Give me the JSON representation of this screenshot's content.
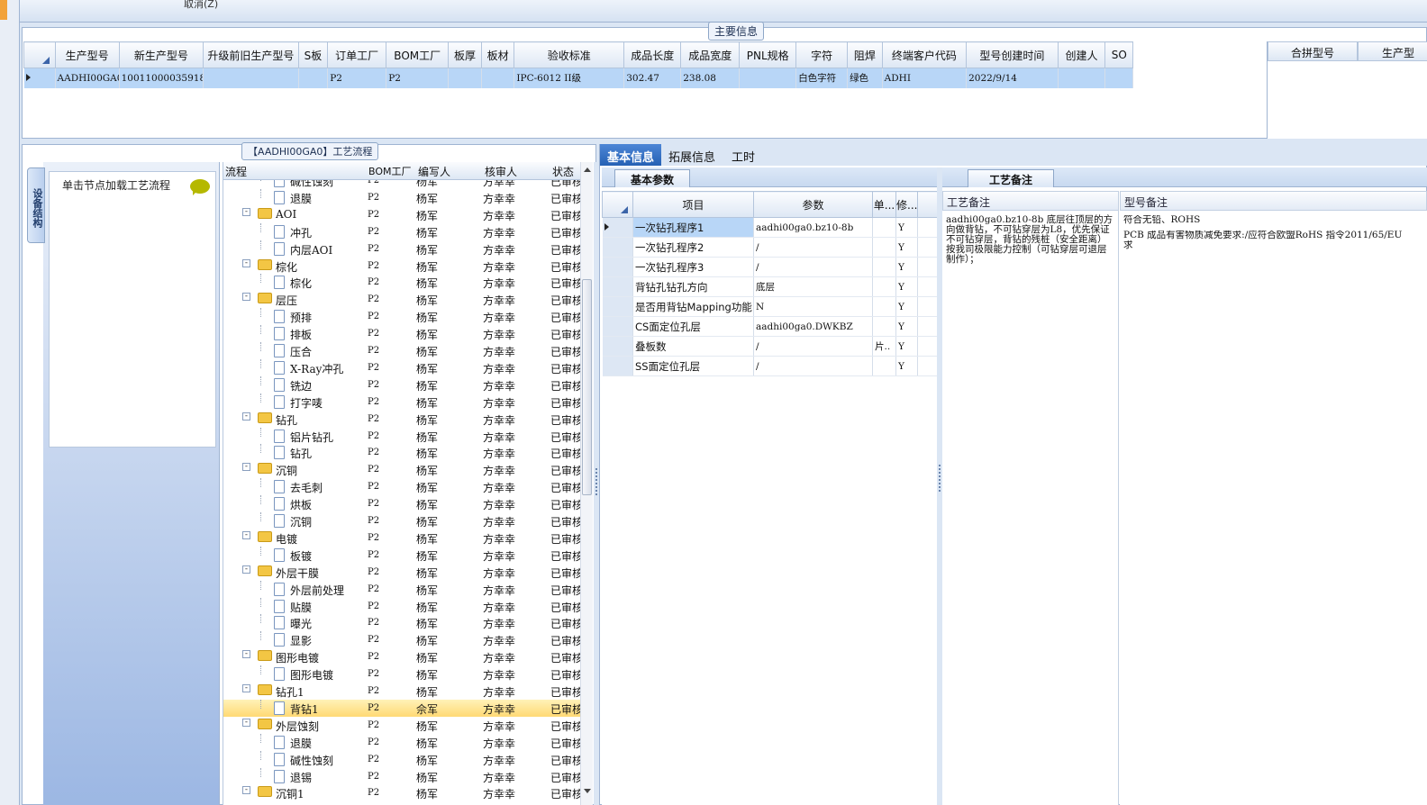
{
  "top_bar": {
    "cancel_label": "取消(Z)"
  },
  "main_info": {
    "group_title": "主要信息",
    "columns": [
      "生产型号",
      "新生产型号",
      "升级前旧生产型号",
      "S板",
      "订单工厂",
      "BOM工厂",
      "板厚",
      "板材",
      "验收标准",
      "成品长度",
      "成品宽度",
      "PNL规格",
      "字符",
      "阻焊",
      "终端客户代码",
      "型号创建时间",
      "创建人",
      "SO"
    ],
    "row": [
      "AADHI00GA0",
      "10011000035918",
      "",
      "",
      "P2",
      "P2",
      "",
      "",
      "IPC-6012 II级",
      "302.47",
      "238.08",
      "",
      "白色字符",
      "绿色",
      "ADHI",
      "2022/9/14",
      "",
      ""
    ],
    "merge_columns": [
      "合拼型号",
      "生产型"
    ]
  },
  "lower_left": {
    "group_title": "【AADHI00GA0】工艺流程",
    "vertical_tab": "设备结构",
    "hint": "单击节点加载工艺流程"
  },
  "tree": {
    "columns": [
      "流程",
      "BOM工厂",
      "编写人",
      "核审人",
      "状态"
    ],
    "rows": [
      {
        "name": "碱性蚀刻",
        "level": 1,
        "bom": "P2",
        "writer": "杨军",
        "reviewer": "方幸幸",
        "status": "已审核"
      },
      {
        "name": "退膜",
        "level": 1,
        "bom": "P2",
        "writer": "杨军",
        "reviewer": "方幸幸",
        "status": "已审核"
      },
      {
        "name": "AOI",
        "level": 0,
        "bom": "P2",
        "writer": "杨军",
        "reviewer": "方幸幸",
        "status": "已审核"
      },
      {
        "name": "冲孔",
        "level": 1,
        "bom": "P2",
        "writer": "杨军",
        "reviewer": "方幸幸",
        "status": "已审核"
      },
      {
        "name": "内层AOI",
        "level": 1,
        "bom": "P2",
        "writer": "杨军",
        "reviewer": "方幸幸",
        "status": "已审核"
      },
      {
        "name": "棕化",
        "level": 0,
        "bom": "P2",
        "writer": "杨军",
        "reviewer": "方幸幸",
        "status": "已审核"
      },
      {
        "name": "棕化",
        "level": 1,
        "bom": "P2",
        "writer": "杨军",
        "reviewer": "方幸幸",
        "status": "已审核"
      },
      {
        "name": "层压",
        "level": 0,
        "bom": "P2",
        "writer": "杨军",
        "reviewer": "方幸幸",
        "status": "已审核"
      },
      {
        "name": "预排",
        "level": 1,
        "bom": "P2",
        "writer": "杨军",
        "reviewer": "方幸幸",
        "status": "已审核"
      },
      {
        "name": "排板",
        "level": 1,
        "bom": "P2",
        "writer": "杨军",
        "reviewer": "方幸幸",
        "status": "已审核"
      },
      {
        "name": "压合",
        "level": 1,
        "bom": "P2",
        "writer": "杨军",
        "reviewer": "方幸幸",
        "status": "已审核"
      },
      {
        "name": "X-Ray冲孔",
        "level": 1,
        "bom": "P2",
        "writer": "杨军",
        "reviewer": "方幸幸",
        "status": "已审核"
      },
      {
        "name": "铣边",
        "level": 1,
        "bom": "P2",
        "writer": "杨军",
        "reviewer": "方幸幸",
        "status": "已审核"
      },
      {
        "name": "打字唛",
        "level": 1,
        "bom": "P2",
        "writer": "杨军",
        "reviewer": "方幸幸",
        "status": "已审核"
      },
      {
        "name": "钻孔",
        "level": 0,
        "bom": "P2",
        "writer": "杨军",
        "reviewer": "方幸幸",
        "status": "已审核"
      },
      {
        "name": "铝片钻孔",
        "level": 1,
        "bom": "P2",
        "writer": "杨军",
        "reviewer": "方幸幸",
        "status": "已审核"
      },
      {
        "name": "钻孔",
        "level": 1,
        "bom": "P2",
        "writer": "杨军",
        "reviewer": "方幸幸",
        "status": "已审核"
      },
      {
        "name": "沉铜",
        "level": 0,
        "bom": "P2",
        "writer": "杨军",
        "reviewer": "方幸幸",
        "status": "已审核"
      },
      {
        "name": "去毛刺",
        "level": 1,
        "bom": "P2",
        "writer": "杨军",
        "reviewer": "方幸幸",
        "status": "已审核"
      },
      {
        "name": "烘板",
        "level": 1,
        "bom": "P2",
        "writer": "杨军",
        "reviewer": "方幸幸",
        "status": "已审核"
      },
      {
        "name": "沉铜",
        "level": 1,
        "bom": "P2",
        "writer": "杨军",
        "reviewer": "方幸幸",
        "status": "已审核"
      },
      {
        "name": "电镀",
        "level": 0,
        "bom": "P2",
        "writer": "杨军",
        "reviewer": "方幸幸",
        "status": "已审核"
      },
      {
        "name": "板镀",
        "level": 1,
        "bom": "P2",
        "writer": "杨军",
        "reviewer": "方幸幸",
        "status": "已审核"
      },
      {
        "name": "外层干膜",
        "level": 0,
        "bom": "P2",
        "writer": "杨军",
        "reviewer": "方幸幸",
        "status": "已审核"
      },
      {
        "name": "外层前处理",
        "level": 1,
        "bom": "P2",
        "writer": "杨军",
        "reviewer": "方幸幸",
        "status": "已审核"
      },
      {
        "name": "贴膜",
        "level": 1,
        "bom": "P2",
        "writer": "杨军",
        "reviewer": "方幸幸",
        "status": "已审核"
      },
      {
        "name": "曝光",
        "level": 1,
        "bom": "P2",
        "writer": "杨军",
        "reviewer": "方幸幸",
        "status": "已审核"
      },
      {
        "name": "显影",
        "level": 1,
        "bom": "P2",
        "writer": "杨军",
        "reviewer": "方幸幸",
        "status": "已审核"
      },
      {
        "name": "图形电镀",
        "level": 0,
        "bom": "P2",
        "writer": "杨军",
        "reviewer": "方幸幸",
        "status": "已审核"
      },
      {
        "name": "图形电镀",
        "level": 1,
        "bom": "P2",
        "writer": "杨军",
        "reviewer": "方幸幸",
        "status": "已审核"
      },
      {
        "name": "钻孔1",
        "level": 0,
        "bom": "P2",
        "writer": "杨军",
        "reviewer": "方幸幸",
        "status": "已审核"
      },
      {
        "name": "背钻1",
        "level": 1,
        "bom": "P2",
        "writer": "佘军",
        "reviewer": "方幸幸",
        "status": "已审核",
        "selected": true
      },
      {
        "name": "外层蚀刻",
        "level": 0,
        "bom": "P2",
        "writer": "杨军",
        "reviewer": "方幸幸",
        "status": "已审核"
      },
      {
        "name": "退膜",
        "level": 1,
        "bom": "P2",
        "writer": "杨军",
        "reviewer": "方幸幸",
        "status": "已审核"
      },
      {
        "name": "碱性蚀刻",
        "level": 1,
        "bom": "P2",
        "writer": "杨军",
        "reviewer": "方幸幸",
        "status": "已审核"
      },
      {
        "name": "退锡",
        "level": 1,
        "bom": "P2",
        "writer": "杨军",
        "reviewer": "方幸幸",
        "status": "已审核"
      },
      {
        "name": "沉铜1",
        "level": 0,
        "bom": "P2",
        "writer": "杨军",
        "reviewer": "方幸幸",
        "status": "已审核"
      }
    ]
  },
  "right_tabs": [
    "基本信息",
    "拓展信息",
    "工时"
  ],
  "basic": {
    "tab_label": "基本参数",
    "columns": [
      "项目",
      "参数",
      "单...",
      "修..."
    ],
    "rows": [
      {
        "item": "一次钻孔程序1",
        "param": "aadhi00ga0.bz10-8b",
        "unit": "",
        "mod": "Y"
      },
      {
        "item": "一次钻孔程序2",
        "param": "/",
        "unit": "",
        "mod": "Y"
      },
      {
        "item": "一次钻孔程序3",
        "param": "/",
        "unit": "",
        "mod": "Y"
      },
      {
        "item": "背钻孔钻孔方向",
        "param": "底层",
        "unit": "",
        "mod": "Y"
      },
      {
        "item": "是否用背钻Mapping功能",
        "param": "N",
        "unit": "",
        "mod": "Y"
      },
      {
        "item": "CS面定位孔层",
        "param": "aadhi00ga0.DWKBZ",
        "unit": "",
        "mod": "Y"
      },
      {
        "item": "叠板数",
        "param": "/",
        "unit": "片..",
        "mod": "Y"
      },
      {
        "item": "SS面定位孔层",
        "param": "/",
        "unit": "",
        "mod": "Y"
      }
    ]
  },
  "notes": {
    "tab_label": "工艺备注",
    "col1_header": "工艺备注",
    "col2_header": "型号备注",
    "process_note": "aadhi00ga0.bz10-8b 底层往顶层的方向做背钻，不可钻穿层为L8，优先保证不可钻穿层，背钻的残桩（安全距离）按我司极限能力控制（可钻穿层可退层制作）；",
    "model_note_lines": [
      "符合无铅、ROHS",
      "PCB 成品有害物质减免要求:/应符合欧盟RoHS 指令2011/65/EU",
      "求"
    ]
  }
}
